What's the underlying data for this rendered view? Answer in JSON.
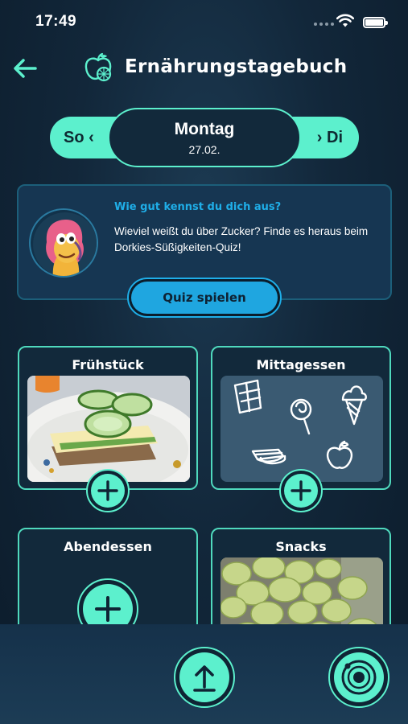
{
  "status_bar": {
    "time": "17:49"
  },
  "header": {
    "title": "Ernährungstagebuch"
  },
  "day_nav": {
    "prev_label": "So ‹",
    "next_label": "› Di",
    "current_day": "Montag",
    "current_date": "27.02."
  },
  "quiz": {
    "heading": "Wie gut kennst du dich aus?",
    "text": "Wieviel weißt du über Zucker? Finde es heraus beim Dorkies-Süßigkeiten-Quiz!",
    "button_label": "Quiz spielen"
  },
  "meals": [
    {
      "title": "Frühstück",
      "image": "sandwich-photo"
    },
    {
      "title": "Mittagessen",
      "image": "sweets-placeholder-icons"
    },
    {
      "title": "Abendessen",
      "image": ""
    },
    {
      "title": "Snacks",
      "image": "grapes-photo"
    }
  ],
  "colors": {
    "accent": "#5cf0cd",
    "quiz_heading": "#1faee8",
    "background": "#12273a"
  },
  "icons": {
    "back": "arrow-left-icon",
    "logo": "fruit-logo-icon",
    "add": "plus-icon",
    "upload": "upload-icon",
    "profile": "planet-orbit-icon"
  }
}
